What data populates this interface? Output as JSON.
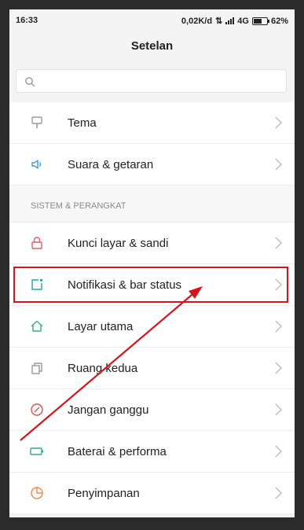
{
  "status": {
    "time": "16:33",
    "speed": "0,02K/d",
    "network": "4G",
    "battery": "62%",
    "battery_level": 0.62
  },
  "header": {
    "title": "Setelan"
  },
  "search": {
    "placeholder": ""
  },
  "items_top": [
    {
      "label": "Tema",
      "icon": "brush-icon",
      "color": "#9a9a9a"
    },
    {
      "label": "Suara & getaran",
      "icon": "speaker-icon",
      "color": "#3b9ad6"
    }
  ],
  "section_label": "SISTEM & PERANGKAT",
  "items": [
    {
      "label": "Kunci layar & sandi",
      "icon": "lock-icon",
      "color": "#e35c6f"
    },
    {
      "label": "Notifikasi & bar status",
      "icon": "notification-icon",
      "color": "#1ca7a1",
      "highlighted": true
    },
    {
      "label": "Layar utama",
      "icon": "home-icon",
      "color": "#2fb27f"
    },
    {
      "label": "Ruang kedua",
      "icon": "copy-icon",
      "color": "#9a9a9a"
    },
    {
      "label": "Jangan ganggu",
      "icon": "dnd-icon",
      "color": "#d9534f"
    },
    {
      "label": "Baterai & performa",
      "icon": "battery-icon",
      "color": "#2fb27f"
    },
    {
      "label": "Penyimpanan",
      "icon": "storage-icon",
      "color": "#f0884a"
    }
  ],
  "colors": {
    "highlight": "#d4161c",
    "arrow": "#d4161c"
  }
}
